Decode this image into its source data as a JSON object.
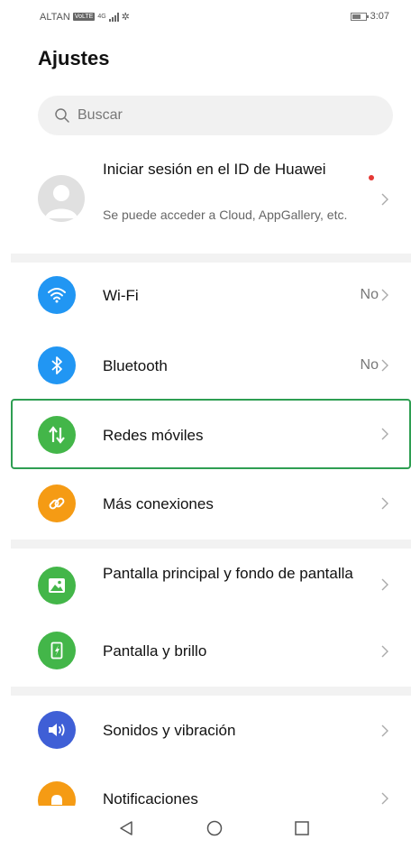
{
  "status_bar": {
    "carrier": "ALTAN",
    "volte": "VoLTE",
    "network": "4G",
    "time": "3:07"
  },
  "page_title": "Ajustes",
  "search": {
    "placeholder": "Buscar"
  },
  "account": {
    "title": "Iniciar sesión en el ID de Huawei",
    "subtitle": "Se puede acceder a Cloud, AppGallery, etc."
  },
  "settings": [
    {
      "label": "Wi-Fi",
      "value": "No",
      "icon": "wifi-icon",
      "color": "#2196f3"
    },
    {
      "label": "Bluetooth",
      "value": "No",
      "icon": "bluetooth-icon",
      "color": "#2196f3"
    },
    {
      "label": "Redes móviles",
      "value": "",
      "icon": "mobile-data-icon",
      "color": "#43b649",
      "selected": true
    },
    {
      "label": "Más conexiones",
      "value": "",
      "icon": "link-icon",
      "color": "#f59b14"
    },
    {
      "label": "Pantalla principal y fondo de pantalla",
      "value": "",
      "icon": "wallpaper-icon",
      "color": "#43b649"
    },
    {
      "label": "Pantalla y brillo",
      "value": "",
      "icon": "display-brightness-icon",
      "color": "#43b649"
    },
    {
      "label": "Sonidos y vibración",
      "value": "",
      "icon": "sound-icon",
      "color": "#3f5fd6"
    },
    {
      "label": "Notificaciones",
      "value": "",
      "icon": "notification-icon",
      "color": "#f59b14"
    }
  ],
  "nav_bar": {
    "back": "back-icon",
    "home": "home-icon",
    "recents": "recents-icon"
  }
}
